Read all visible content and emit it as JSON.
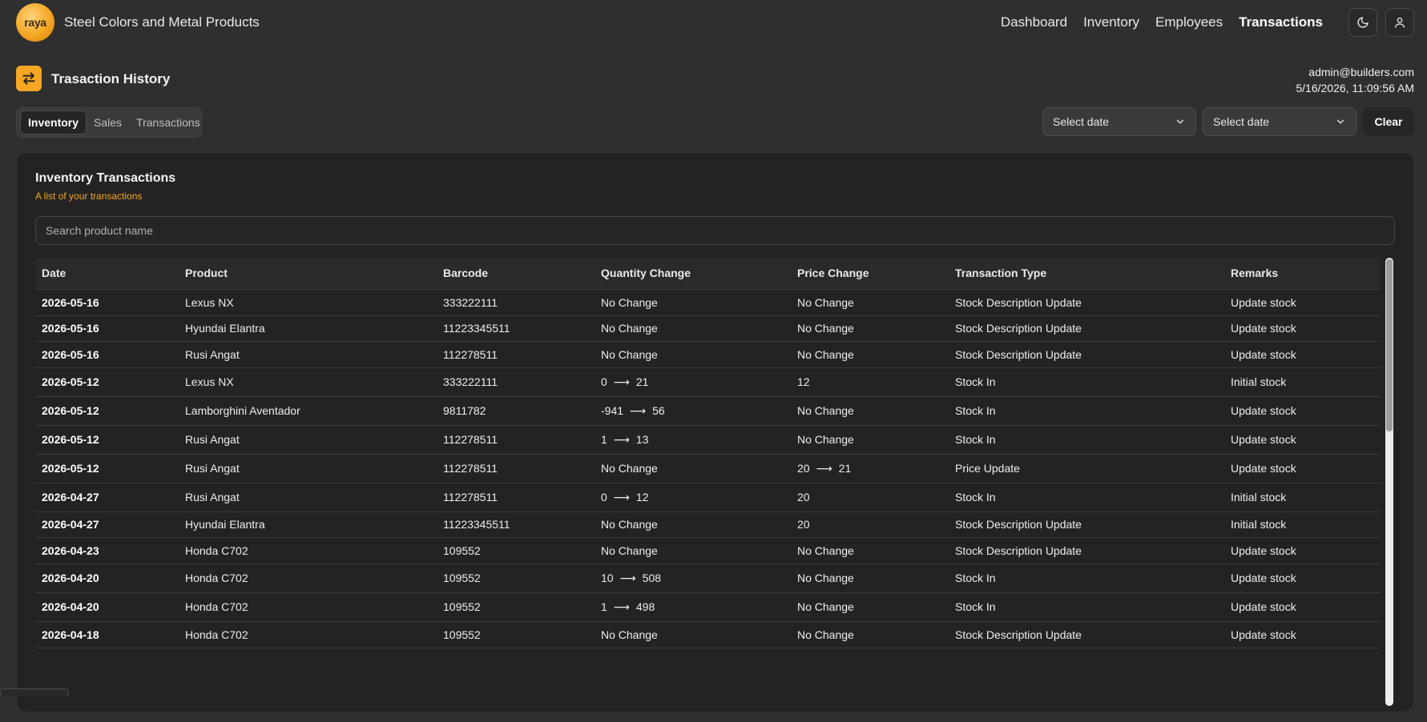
{
  "header": {
    "logo_text": "raya",
    "brand": "Steel Colors and Metal Products",
    "nav": [
      {
        "label": "Dashboard"
      },
      {
        "label": "Inventory"
      },
      {
        "label": "Employees"
      },
      {
        "label": "Transactions",
        "active": true
      }
    ],
    "theme_icon": "moon-icon",
    "user_icon": "user-icon"
  },
  "page": {
    "title": "Trasaction History",
    "icon": "swap-arrows-icon",
    "user_email": "admin@builders.com",
    "datetime": "5/16/2026, 11:09:56 AM"
  },
  "tabs": [
    {
      "label": "Inventory",
      "active": true
    },
    {
      "label": "Sales"
    },
    {
      "label": "Transactions"
    }
  ],
  "filters": {
    "start_date_placeholder": "Select date",
    "end_date_placeholder": "Select date",
    "clear_label": "Clear"
  },
  "card": {
    "title": "Inventory Transactions",
    "subtitle": "A list of your transactions",
    "search_placeholder": "Search product name"
  },
  "table": {
    "columns": [
      "Date",
      "Product",
      "Barcode",
      "Quantity Change",
      "Price Change",
      "Transaction Type",
      "Remarks"
    ],
    "rows": [
      {
        "date": "2026-05-16",
        "product": "Lexus NX",
        "barcode": "333222111",
        "qty": "No Change",
        "price": "No Change",
        "type": "Stock Description Update",
        "remarks": "Update stock"
      },
      {
        "date": "2026-05-16",
        "product": "Hyundai Elantra",
        "barcode": "11223345511",
        "qty": "No Change",
        "price": "No Change",
        "type": "Stock Description Update",
        "remarks": "Update stock"
      },
      {
        "date": "2026-05-16",
        "product": "Rusi Angat",
        "barcode": "112278511",
        "qty": "No Change",
        "price": "No Change",
        "type": "Stock Description Update",
        "remarks": "Update stock"
      },
      {
        "date": "2026-05-12",
        "product": "Lexus NX",
        "barcode": "333222111",
        "qty_from": "0",
        "qty_to": "21",
        "price": "12",
        "type": "Stock In",
        "remarks": "Initial stock"
      },
      {
        "date": "2026-05-12",
        "product": "Lamborghini Aventador",
        "barcode": "9811782",
        "qty_from": "-941",
        "qty_to": "56",
        "price": "No Change",
        "type": "Stock In",
        "remarks": "Update stock"
      },
      {
        "date": "2026-05-12",
        "product": "Rusi Angat",
        "barcode": "112278511",
        "qty_from": "1",
        "qty_to": "13",
        "price": "No Change",
        "type": "Stock In",
        "remarks": "Update stock"
      },
      {
        "date": "2026-05-12",
        "product": "Rusi Angat",
        "barcode": "112278511",
        "qty": "No Change",
        "price_from": "20",
        "price_to": "21",
        "type": "Price Update",
        "remarks": "Update stock"
      },
      {
        "date": "2026-04-27",
        "product": "Rusi Angat",
        "barcode": "112278511",
        "qty_from": "0",
        "qty_to": "12",
        "price": "20",
        "type": "Stock In",
        "remarks": "Initial stock"
      },
      {
        "date": "2026-04-27",
        "product": "Hyundai Elantra",
        "barcode": "11223345511",
        "qty": "No Change",
        "price": "20",
        "type": "Stock Description Update",
        "remarks": "Initial stock"
      },
      {
        "date": "2026-04-23",
        "product": "Honda C702",
        "barcode": "109552",
        "qty": "No Change",
        "price": "No Change",
        "type": "Stock Description Update",
        "remarks": "Update stock"
      },
      {
        "date": "2026-04-20",
        "product": "Honda C702",
        "barcode": "109552",
        "qty_from": "10",
        "qty_to": "508",
        "price": "No Change",
        "type": "Stock In",
        "remarks": "Update stock"
      },
      {
        "date": "2026-04-20",
        "product": "Honda C702",
        "barcode": "109552",
        "qty_from": "1",
        "qty_to": "498",
        "price": "No Change",
        "type": "Stock In",
        "remarks": "Update stock"
      },
      {
        "date": "2026-04-18",
        "product": "Honda C702",
        "barcode": "109552",
        "qty": "No Change",
        "price": "No Change",
        "type": "Stock Description Update",
        "remarks": "Update stock"
      }
    ]
  },
  "colors": {
    "accent": "#f5a623",
    "background": "#2f2f2f",
    "card": "#232323"
  }
}
